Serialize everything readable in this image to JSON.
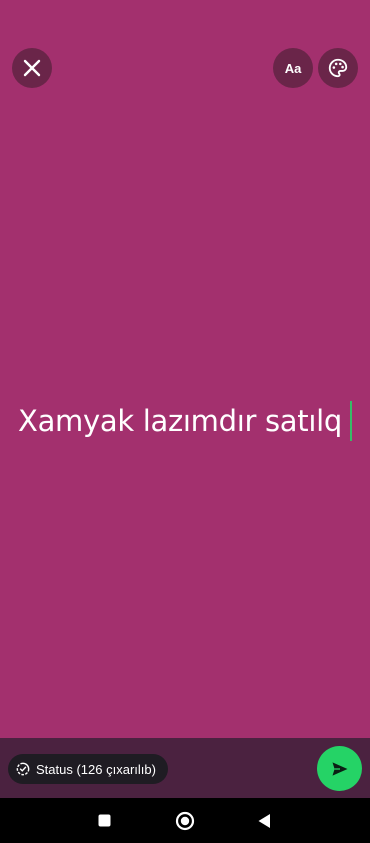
{
  "header": {
    "close_icon": "close-icon",
    "font_button_label": "Aa",
    "palette_icon": "palette-icon"
  },
  "status": {
    "text": "Xamyak lazımdır satılq"
  },
  "footer": {
    "privacy_label": "Status (126 çıxarılıb)",
    "privacy_icon": "status-privacy-icon",
    "send_icon": "send-icon"
  },
  "colors": {
    "background": "#a3306e",
    "accent": "#25d366"
  },
  "nav": {
    "recents_icon": "square-icon",
    "home_icon": "circle-icon",
    "back_icon": "triangle-back-icon"
  }
}
